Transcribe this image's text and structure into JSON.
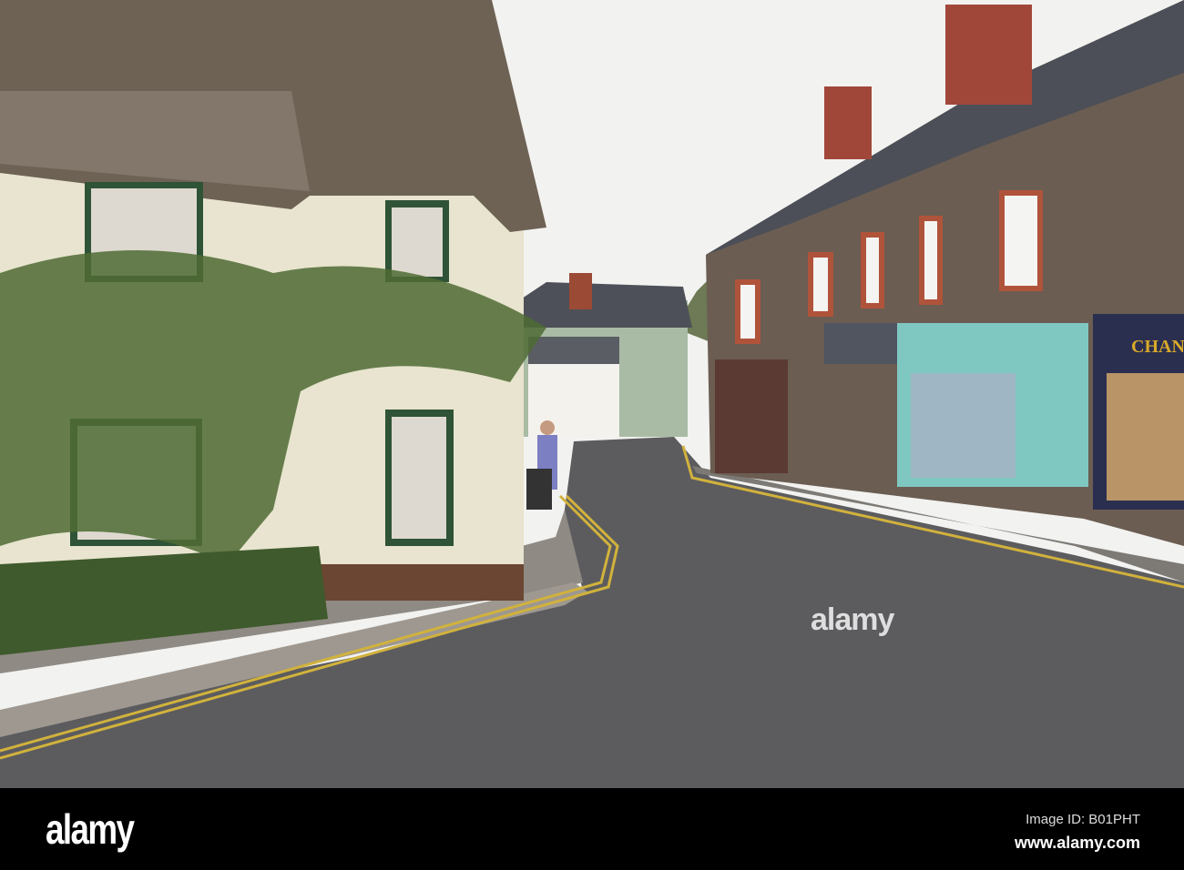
{
  "photo": {
    "shop_sign": "CHANIN",
    "watermark": "alamy"
  },
  "footer": {
    "logo": "alamy",
    "image_id": "Image ID: B01PHT",
    "website": "www.alamy.com"
  }
}
